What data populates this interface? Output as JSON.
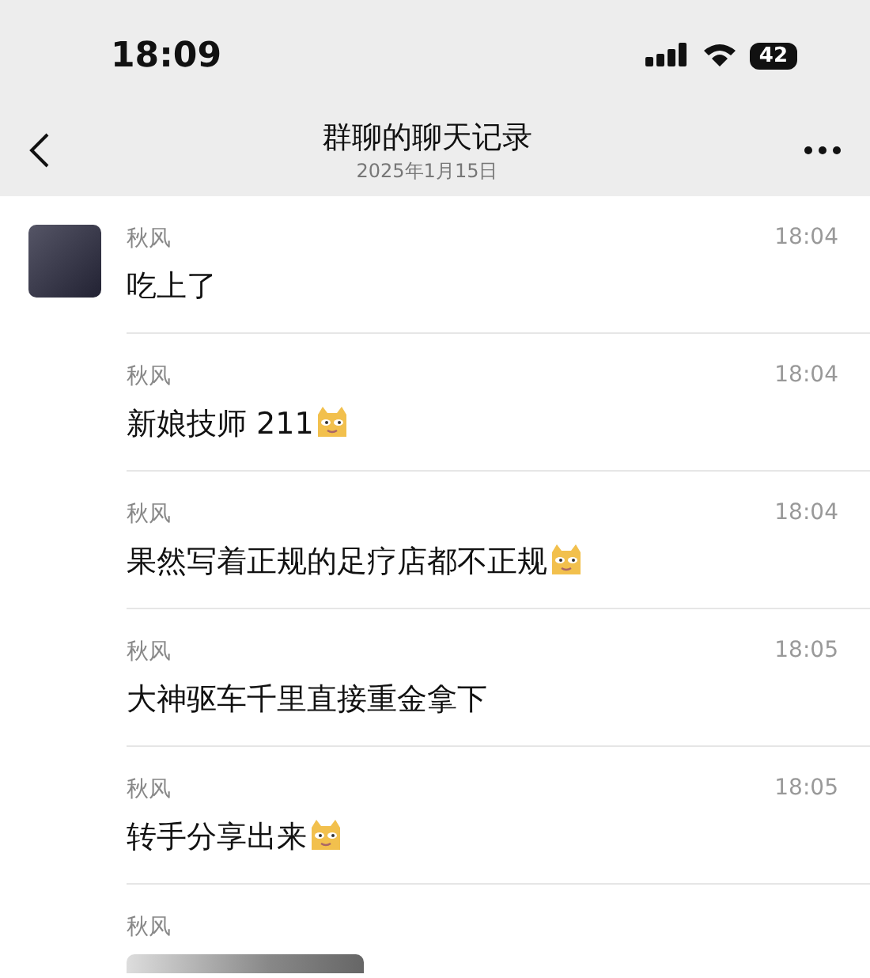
{
  "status_bar": {
    "time": "18:09",
    "battery": "42"
  },
  "nav": {
    "title": "群聊的聊天记录",
    "subtitle": "2025年1月15日"
  },
  "messages": [
    {
      "kind": "text",
      "sender": "秋风",
      "avatar": true,
      "text": "吃上了",
      "emoji": false,
      "time": "18:04"
    },
    {
      "kind": "text",
      "sender": "秋风",
      "avatar": false,
      "text": "新娘技师 211",
      "emoji": true,
      "time": "18:04"
    },
    {
      "kind": "text",
      "sender": "秋风",
      "avatar": false,
      "text": "果然写着正规的足疗店都不正规",
      "emoji": true,
      "time": "18:04"
    },
    {
      "kind": "text",
      "sender": "秋风",
      "avatar": false,
      "text": "大神驱车千里直接重金拿下",
      "emoji": false,
      "time": "18:05"
    },
    {
      "kind": "text",
      "sender": "秋风",
      "avatar": false,
      "text": "转手分享出来",
      "emoji": true,
      "time": "18:05"
    },
    {
      "kind": "image",
      "sender": "秋风",
      "avatar": false
    }
  ]
}
